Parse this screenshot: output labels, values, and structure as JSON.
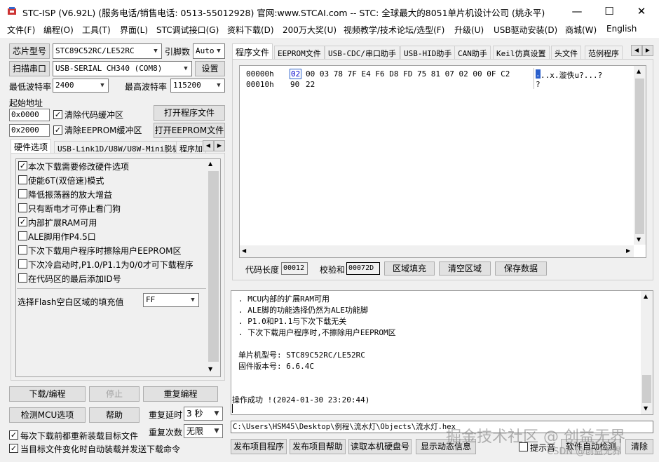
{
  "window": {
    "title": "STC-ISP (V6.92L) (服务电话/销售电话: 0513-55012928) 官网:www.STCAI.com  -- STC: 全球最大的8051单片机设计公司 (姚永平)",
    "min": "—",
    "max": "☐",
    "close": "✕"
  },
  "menu": [
    "文件(F)",
    "编程(O)",
    "工具(T)",
    "界面(L)",
    "STC调试接口(G)",
    "资料下载(D)",
    "200万大奖(U)",
    "视频教学/技术论坛/选型(F)",
    "升级(U)",
    "USB驱动安装(D)",
    "商城(W)",
    "English"
  ],
  "left": {
    "chip_btn": "芯片型号",
    "chip_value": "STC89C52RC/LE52RC",
    "pin_label": "引脚数",
    "pin_value": "Auto",
    "scan_btn": "扫描串口",
    "port_value": "USB-SERIAL CH340 (COM8)",
    "settings_btn": "设置",
    "min_baud_label": "最低波特率",
    "min_baud_value": "2400",
    "max_baud_label": "最高波特率",
    "max_baud_value": "115200",
    "start_addr_label": "起始地址",
    "addr1": "0x0000",
    "clear_code_label": "清除代码缓冲区",
    "open_prog_btn": "打开程序文件",
    "addr2": "0x2000",
    "clear_eeprom_label": "清除EEPROM缓冲区",
    "open_eeprom_btn": "打开EEPROM文件",
    "tabs": [
      "硬件选项",
      "USB-Link1D/U8W/U8W-Mini脱机",
      "程序加"
    ],
    "options": [
      {
        "label": "本次下载需要修改硬件选项",
        "checked": true
      },
      {
        "label": "使能6T(双倍速)模式",
        "checked": false
      },
      {
        "label": "降低振荡器的放大增益",
        "checked": false
      },
      {
        "label": "只有断电才可停止看门狗",
        "checked": false
      },
      {
        "label": "内部扩展RAM可用",
        "checked": true
      },
      {
        "label": "ALE脚用作P4.5口",
        "checked": false
      },
      {
        "label": "下次下载用户程序时擦除用户EEPROM区",
        "checked": false
      },
      {
        "label": "下次冷启动时,P1.0/P1.1为0/0才可下载程序",
        "checked": false
      },
      {
        "label": "在代码区的最后添加ID号",
        "checked": false
      }
    ],
    "fill_label": "选择Flash空白区域的填充值",
    "fill_value": "FF",
    "download_btn": "下载/编程",
    "stop_btn": "停止",
    "reprogram_btn": "重复编程",
    "detect_btn": "检测MCU选项",
    "help_btn": "帮助",
    "repeat_delay_label": "重复延时",
    "repeat_delay_value": "3 秒",
    "repeat_count_label": "重复次数",
    "repeat_count_value": "无限",
    "reload_label": "每次下载前都重新装载目标文件",
    "auto_label": "当目标文件变化时自动装载并发送下载命令"
  },
  "right": {
    "tabs": [
      "程序文件",
      "EEPROM文件",
      "USB-CDC/串口助手",
      "USB-HID助手",
      "CAN助手",
      "Keil仿真设置",
      "头文件",
      "范例程序"
    ],
    "hex_rows": [
      {
        "addr": "00000h",
        "first": "02",
        "bytes": "00 03 78 7F E4 F6 D8 FD 75 81 07 02 00 0F C2",
        "ascii_first": ".",
        "ascii": "..x.漩佚u?...?"
      },
      {
        "addr": "00010h",
        "first": "90",
        "bytes": "22",
        "ascii_first": "?",
        "ascii": ""
      }
    ],
    "code_len_label": "代码长度",
    "code_len_value": "00012",
    "checksum_label": "校验和",
    "checksum_value": "00072D",
    "fill_btn": "区域填充",
    "clear_btn": "清空区域",
    "save_btn": "保存数据",
    "log_lines": [
      ". MCU内部的扩展RAM可用",
      ". ALE脚的功能选择仍然为ALE功能脚",
      ". P1.0和P1.1与下次下载无关",
      ". 下次下载用户程序时,不擦除用户EEPROM区",
      "",
      "单片机型号: STC89C52RC/LE52RC",
      "固件版本号: 6.6.4C",
      "",
      "",
      "操作成功 !(2024-01-30 23:20:44)"
    ],
    "path": "C:\\Users\\HSM45\\Desktop\\例程\\流水灯\\Objects\\流水灯.hex",
    "publish_btn": "发布项目程序",
    "publish_help_btn": "发布项目帮助",
    "read_disk_btn": "读取本机硬盘号",
    "show_msg_btn": "显示动态信息",
    "hint_btn": "提示音",
    "auto_send_btn": "软件自动检测",
    "clear_log_btn": "清除"
  },
  "watermark": {
    "line1": "掘金技术社区 @ 创益无界",
    "line2": "CSDN @创益无界"
  }
}
